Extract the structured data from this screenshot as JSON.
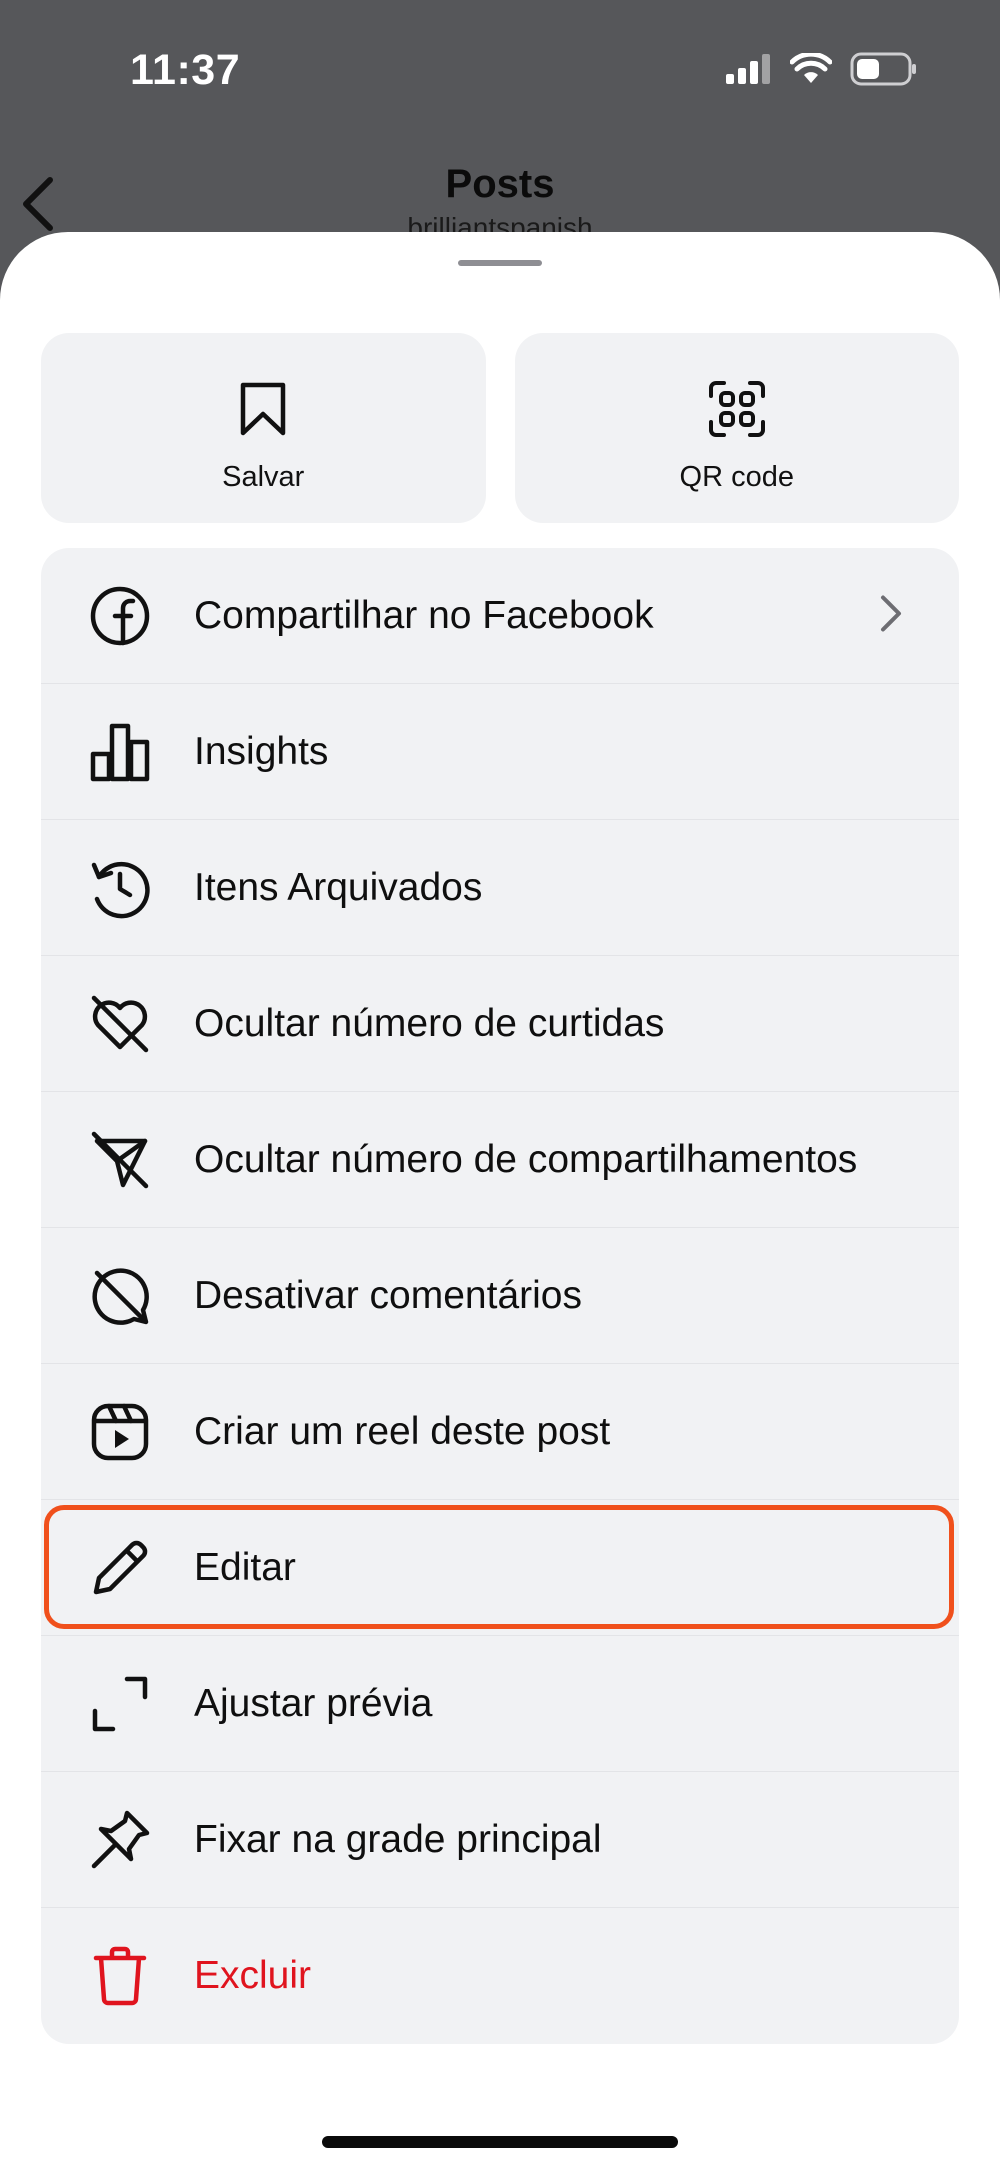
{
  "status_bar": {
    "time": "11:37"
  },
  "header": {
    "title": "Posts",
    "subtitle": "brilliantspanish"
  },
  "quick_actions": [
    {
      "label": "Salvar",
      "icon": "bookmark-icon"
    },
    {
      "label": "QR code",
      "icon": "qr-code-icon"
    }
  ],
  "menu": {
    "items": [
      {
        "label": "Compartilhar no Facebook",
        "icon": "facebook-icon"
      },
      {
        "label": "Insights",
        "icon": "insights-icon"
      },
      {
        "label": "Itens Arquivados",
        "icon": "archive-history-icon"
      },
      {
        "label": "Ocultar número de curtidas",
        "icon": "heart-off-icon"
      },
      {
        "label": "Ocultar número de compartilhamentos",
        "icon": "share-off-icon"
      },
      {
        "label": "Desativar comentários",
        "icon": "comment-off-icon"
      },
      {
        "label": "Criar um reel deste post",
        "icon": "reel-icon"
      },
      {
        "label": "Editar",
        "icon": "pencil-icon"
      },
      {
        "label": "Ajustar prévia",
        "icon": "crop-icon"
      },
      {
        "label": "Fixar na grade principal",
        "icon": "pin-icon"
      },
      {
        "label": "Excluir",
        "icon": "trash-icon"
      }
    ]
  },
  "colors": {
    "highlight": "#f0501c",
    "danger": "#e0141e",
    "card_bg": "#f1f2f4",
    "dim_bg": "#56575a"
  }
}
